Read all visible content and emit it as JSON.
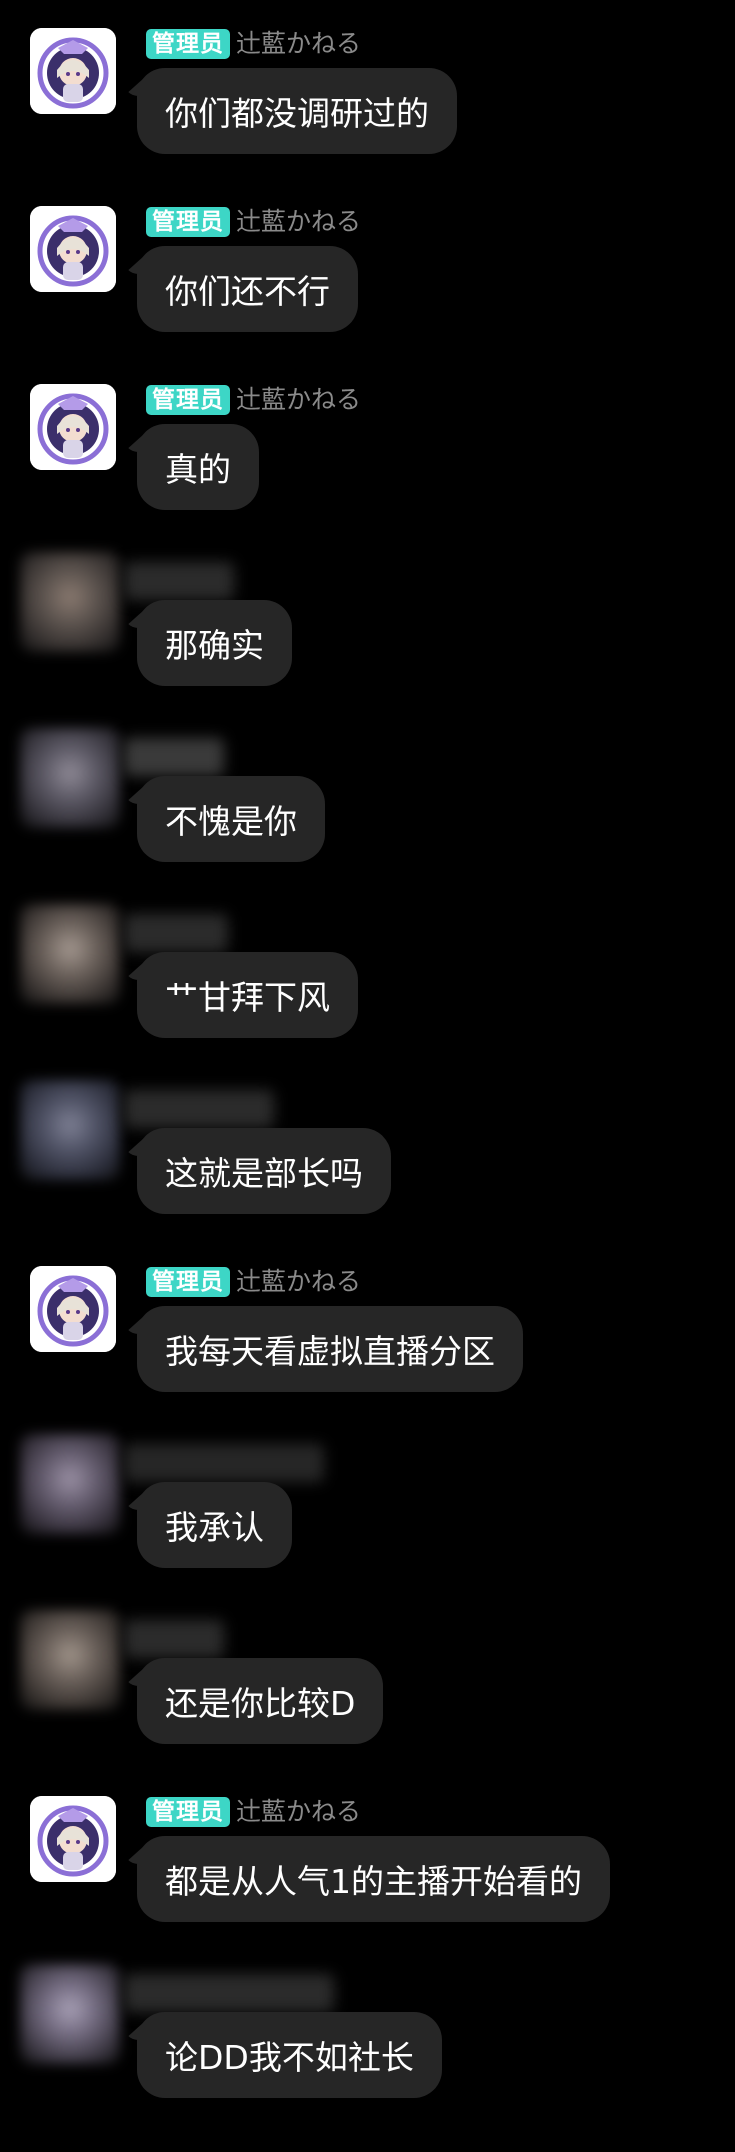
{
  "admin_badge": "管理员",
  "admin_nick": "辻藍かねる",
  "colors": {
    "background": "#000000",
    "bubble": "#262626",
    "badge": "#3dd6c6",
    "nick": "#8a8a8a"
  },
  "messages": [
    {
      "sender": "admin",
      "text": "你们都没调研过的"
    },
    {
      "sender": "admin",
      "text": "你们还不行"
    },
    {
      "sender": "admin",
      "text": "真的"
    },
    {
      "sender": "other",
      "text": "那确实"
    },
    {
      "sender": "other",
      "text": "不愧是你"
    },
    {
      "sender": "other",
      "text": "艹甘拜下风"
    },
    {
      "sender": "other",
      "text": "这就是部长吗"
    },
    {
      "sender": "admin",
      "text": "我每天看虚拟直播分区"
    },
    {
      "sender": "other",
      "text": "我承认"
    },
    {
      "sender": "other",
      "text": "还是你比较D"
    },
    {
      "sender": "admin",
      "text": "都是从人气1的主播开始看的"
    },
    {
      "sender": "other",
      "text": "论DD我不如社长"
    }
  ]
}
